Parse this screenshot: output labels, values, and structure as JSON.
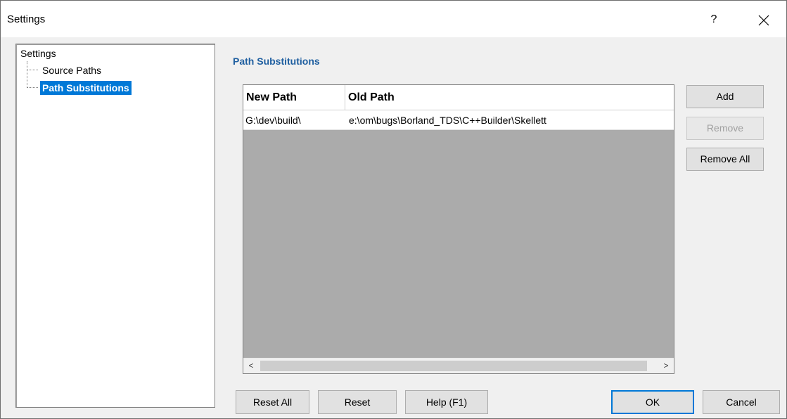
{
  "window": {
    "title": "Settings",
    "help_glyph": "?",
    "close_icon": "close-icon"
  },
  "tree": {
    "root_label": "Settings",
    "items": [
      {
        "label": "Source Paths",
        "selected": false
      },
      {
        "label": "Path Substitutions",
        "selected": true
      }
    ]
  },
  "section": {
    "title": "Path Substitutions"
  },
  "table": {
    "columns": [
      "New Path",
      "Old Path"
    ],
    "rows": [
      [
        "G:\\dev\\build\\",
        "e:\\om\\bugs\\Borland_TDS\\C++Builder\\Skellett"
      ]
    ],
    "scroll_left": "<",
    "scroll_right": ">"
  },
  "side_buttons": {
    "add": "Add",
    "remove": "Remove",
    "remove_all": "Remove All"
  },
  "footer_buttons": {
    "reset_all": "Reset All",
    "reset": "Reset",
    "help": "Help (F1)",
    "ok": "OK",
    "cancel": "Cancel"
  },
  "colors": {
    "selection": "#0078d7",
    "section_title": "#1f5fa0",
    "grid_background": "#ababab"
  }
}
